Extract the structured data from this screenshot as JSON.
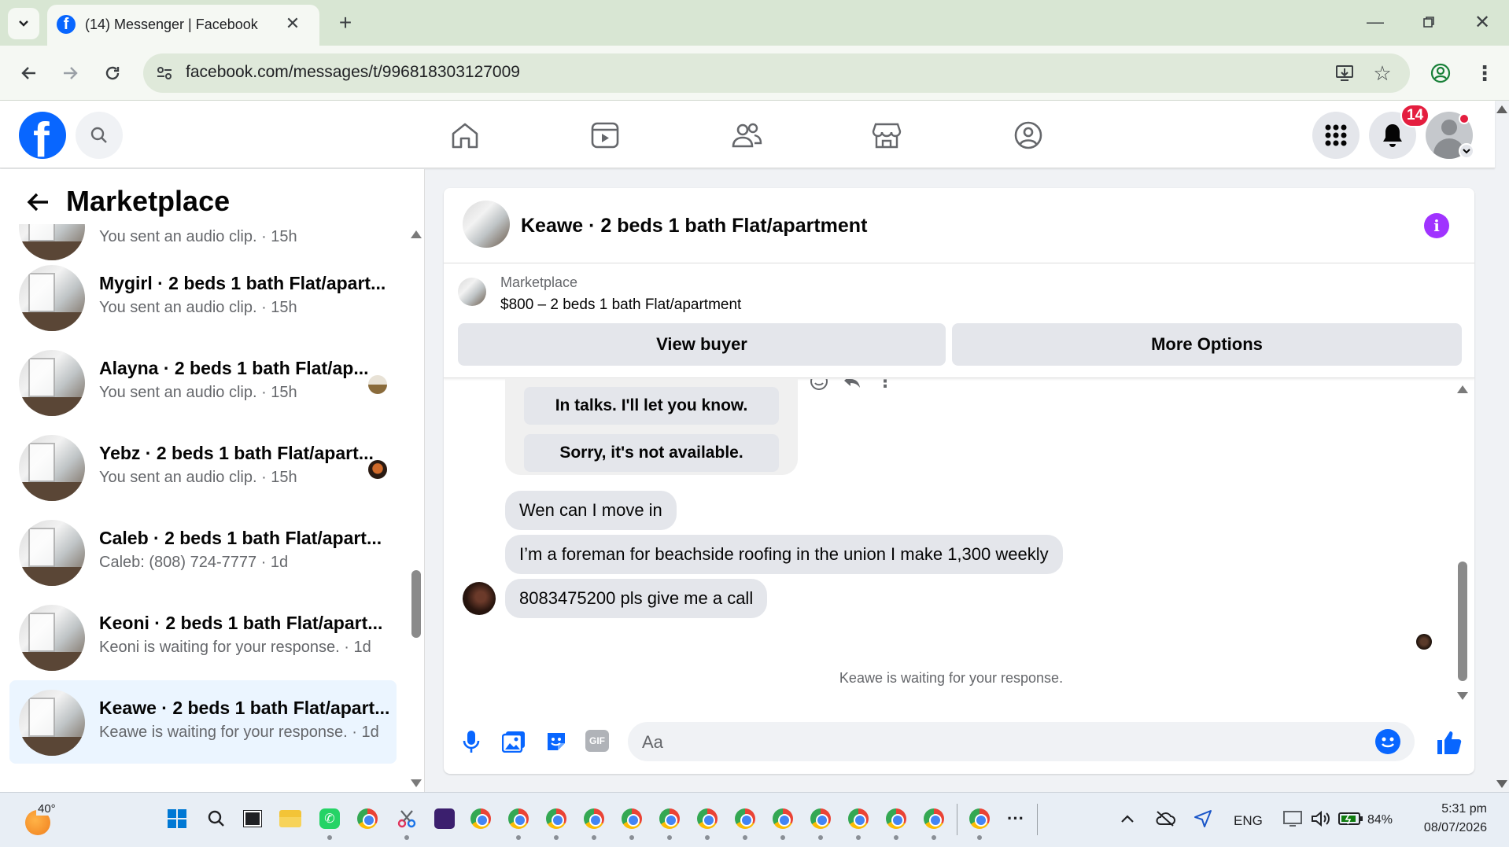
{
  "browser": {
    "tab_title": "(14) Messenger | Facebook",
    "url": "facebook.com/messages/t/996818303127009"
  },
  "fb": {
    "notification_count": "14"
  },
  "left": {
    "title": "Marketplace",
    "conversations": [
      {
        "name": "",
        "subtitle": "You sent an audio clip. · 15h"
      },
      {
        "name": "Mygirl · 2 beds 1 bath Flat/apart...",
        "subtitle": "You sent an audio clip. · 15h"
      },
      {
        "name": "Alayna · 2 beds 1 bath Flat/ap...",
        "subtitle": "You sent an audio clip. · 15h"
      },
      {
        "name": "Yebz · 2 beds 1 bath Flat/apart...",
        "subtitle": "You sent an audio clip. · 15h"
      },
      {
        "name": "Caleb · 2 beds 1 bath Flat/apart...",
        "subtitle": "Caleb: (808) 724-7777 · 1d"
      },
      {
        "name": "Keoni · 2 beds 1 bath Flat/apart...",
        "subtitle": "Keoni is waiting for your response. · 1d"
      },
      {
        "name": "Keawe · 2 beds 1 bath Flat/apart...",
        "subtitle": "Keawe is waiting for your response. · 1d"
      }
    ]
  },
  "chat": {
    "title": "Keawe · 2 beds 1 bath Flat/apartment",
    "listing_label": "Marketplace",
    "listing_title": "$800 – 2 beds 1 bath Flat/apartment",
    "view_buyer": "View buyer",
    "more_options": "More Options",
    "quick_reply_1": "In talks. I'll let you know.",
    "quick_reply_2": "Sorry, it's not available.",
    "messages": [
      "Wen can I move in",
      "I’m a foreman for beachside roofing in the union I make 1,300 weekly",
      "8083475200 pls give me a call"
    ],
    "status": "Keawe is waiting for your response.",
    "input_placeholder": "Aa"
  },
  "taskbar": {
    "weather": "40°",
    "lang": "ENG",
    "battery": "84%",
    "time": "5:31 pm",
    "date": "08/07/2026"
  },
  "colors": {
    "fb_blue": "#0866ff",
    "messenger_purple": "#a033ff",
    "badge_red": "#e41e3f"
  }
}
